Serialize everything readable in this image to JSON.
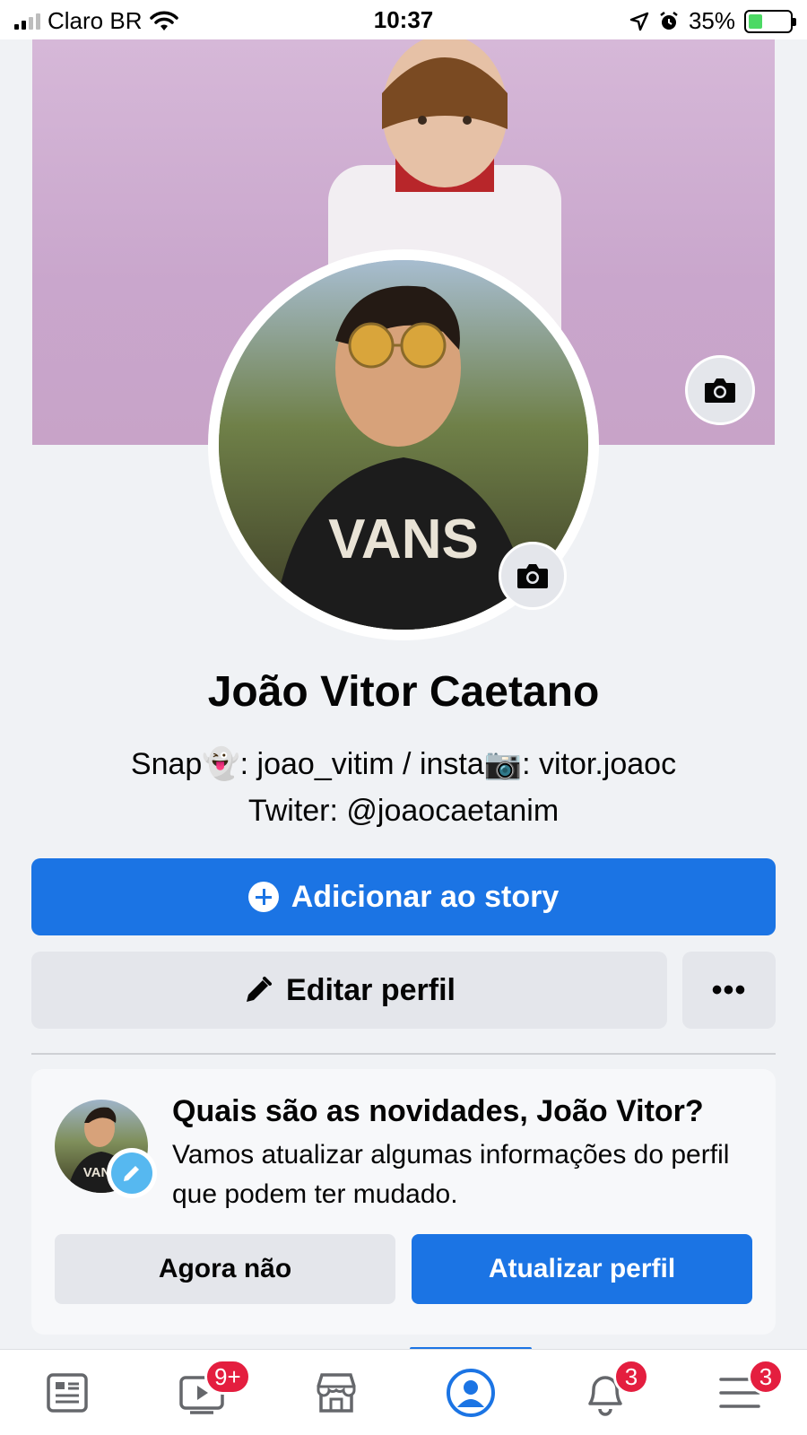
{
  "status_bar": {
    "carrier": "Claro BR",
    "time": "10:37",
    "battery_percent": "35%",
    "battery_level": 0.35,
    "icons": [
      "signal-icon",
      "wifi-icon",
      "location-arrow-icon",
      "alarm-icon",
      "battery-charging-icon"
    ]
  },
  "profile": {
    "name": "João Vitor Caetano",
    "bio_line1": "Snap👻: joao_vitim / insta📷: vitor.joaoc",
    "bio_line2": "Twiter: @joaocaetanim",
    "cover_camera_icon": "camera-icon",
    "avatar_camera_icon": "camera-icon"
  },
  "actions": {
    "story_label": "Adicionar ao story",
    "edit_label": "Editar perfil",
    "more_label": "•••"
  },
  "update_card": {
    "title": "Quais são as novidades, João Vitor?",
    "text": "Vamos atualizar algumas informações do perfil que podem ter mudado.",
    "later_label": "Agora não",
    "update_label": "Atualizar perfil"
  },
  "bottom_nav": {
    "items": [
      {
        "icon": "news-feed-icon",
        "badge": ""
      },
      {
        "icon": "watch-video-icon",
        "badge": "9+"
      },
      {
        "icon": "marketplace-icon",
        "badge": ""
      },
      {
        "icon": "profile-icon",
        "badge": "",
        "active": true
      },
      {
        "icon": "notifications-bell-icon",
        "badge": "3"
      },
      {
        "icon": "menu-icon",
        "badge": "3"
      }
    ]
  },
  "colors": {
    "primary": "#1b74e4",
    "secondary_button": "#e4e6eb",
    "badge": "#e41e3f",
    "background": "#f0f2f5"
  }
}
